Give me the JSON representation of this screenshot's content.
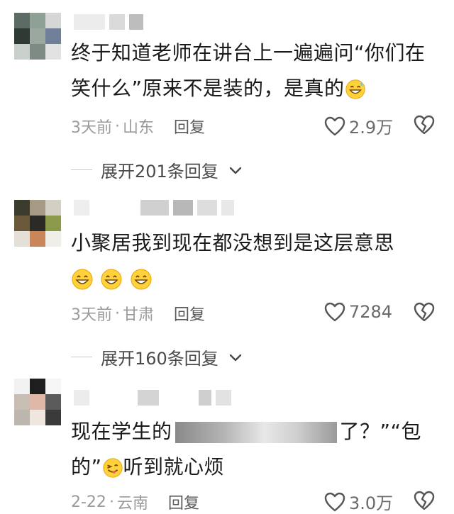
{
  "comments": [
    {
      "text": "终于知道老师在讲台上一遍遍问“你们在笑什么”原来不是装的，是真的",
      "time": "3天前",
      "sep": "·",
      "location": "山东",
      "reply_label": "回复",
      "likes": "2.9万",
      "expand_label": "展开201条回复"
    },
    {
      "text": "小聚居我到现在都没想到是这层意思",
      "time": "3天前",
      "sep": "·",
      "location": "甘肃",
      "reply_label": "回复",
      "likes": "7284",
      "expand_label": "展开160条回复"
    },
    {
      "text_before": "现在学生的",
      "text_after": "了？”“包的”",
      "text_end": "听到就心烦",
      "time": "2-22",
      "sep": "·",
      "location": "云南",
      "reply_label": "回复",
      "likes": "3.0万"
    }
  ],
  "icons": {
    "like": "heart-outline-icon",
    "dislike": "broken-heart-icon",
    "expand": "chevron-down-icon",
    "emoji_sweat": "grinning-sweat-emoji",
    "emoji_smile": "smiling-face-emoji",
    "emoji_tongue": "winking-tongue-emoji"
  }
}
